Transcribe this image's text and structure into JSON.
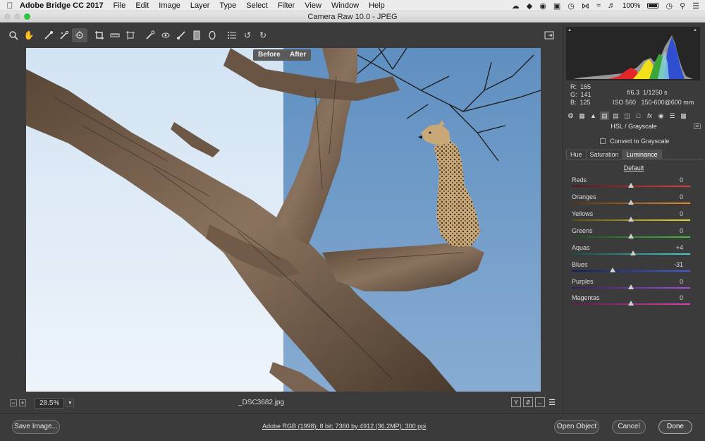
{
  "menubar": {
    "app_name": "Adobe Bridge CC 2017",
    "menus": [
      "File",
      "Edit",
      "Image",
      "Layer",
      "Type",
      "Select",
      "Filter",
      "View",
      "Window",
      "Help"
    ],
    "battery": "100%"
  },
  "window": {
    "title": "Camera Raw 10.0  -  JPEG"
  },
  "toolbar": {
    "tools": [
      "zoom-tool",
      "hand-tool",
      "white-balance-tool",
      "color-sampler-tool",
      "targeted-adjustment-tool",
      "crop-tool",
      "straighten-tool",
      "transform-tool",
      "spot-removal-tool",
      "red-eye-tool",
      "adjustment-brush",
      "graduated-filter",
      "radial-filter",
      "preferences",
      "rotate-ccw",
      "rotate-cw"
    ],
    "active_tool": "targeted-adjustment-tool"
  },
  "preview": {
    "before_label": "Before",
    "after_label": "After",
    "zoom": "28.5%",
    "filename": "_DSC3682.jpg"
  },
  "readout": {
    "r_label": "R:",
    "r": "165",
    "g_label": "G:",
    "g": "141",
    "b_label": "B:",
    "b": "125",
    "aperture": "f/6.3",
    "shutter": "1/1250 s",
    "iso": "ISO 560",
    "lens": "150-600@600 mm"
  },
  "panel": {
    "title": "HSL / Grayscale",
    "grayscale_label": "Convert to Grayscale",
    "tabs": [
      "Hue",
      "Saturation",
      "Luminance"
    ],
    "active_tab": "Luminance",
    "default_label": "Default",
    "sliders": [
      {
        "label": "Reds",
        "value": "0",
        "level": 0
      },
      {
        "label": "Oranges",
        "value": "0",
        "level": 0
      },
      {
        "label": "Yellows",
        "value": "0",
        "level": 0
      },
      {
        "label": "Greens",
        "value": "0",
        "level": 0
      },
      {
        "label": "Aquas",
        "value": "+4",
        "level": 4
      },
      {
        "label": "Blues",
        "value": "-31",
        "level": -31
      },
      {
        "label": "Purples",
        "value": "0",
        "level": 0
      },
      {
        "label": "Magentas",
        "value": "0",
        "level": 0
      }
    ]
  },
  "bottom": {
    "save_label": "Save Image...",
    "workflow_link": "Adobe RGB (1998); 8 bit; 7360 by 4912 (36.2MP); 300 ppi",
    "open_label": "Open Object",
    "cancel_label": "Cancel",
    "done_label": "Done"
  },
  "colors": {
    "sky_before": "#e3edf6",
    "sky_after": "#7fa6cd",
    "panel_bg": "#3b3b3b"
  }
}
